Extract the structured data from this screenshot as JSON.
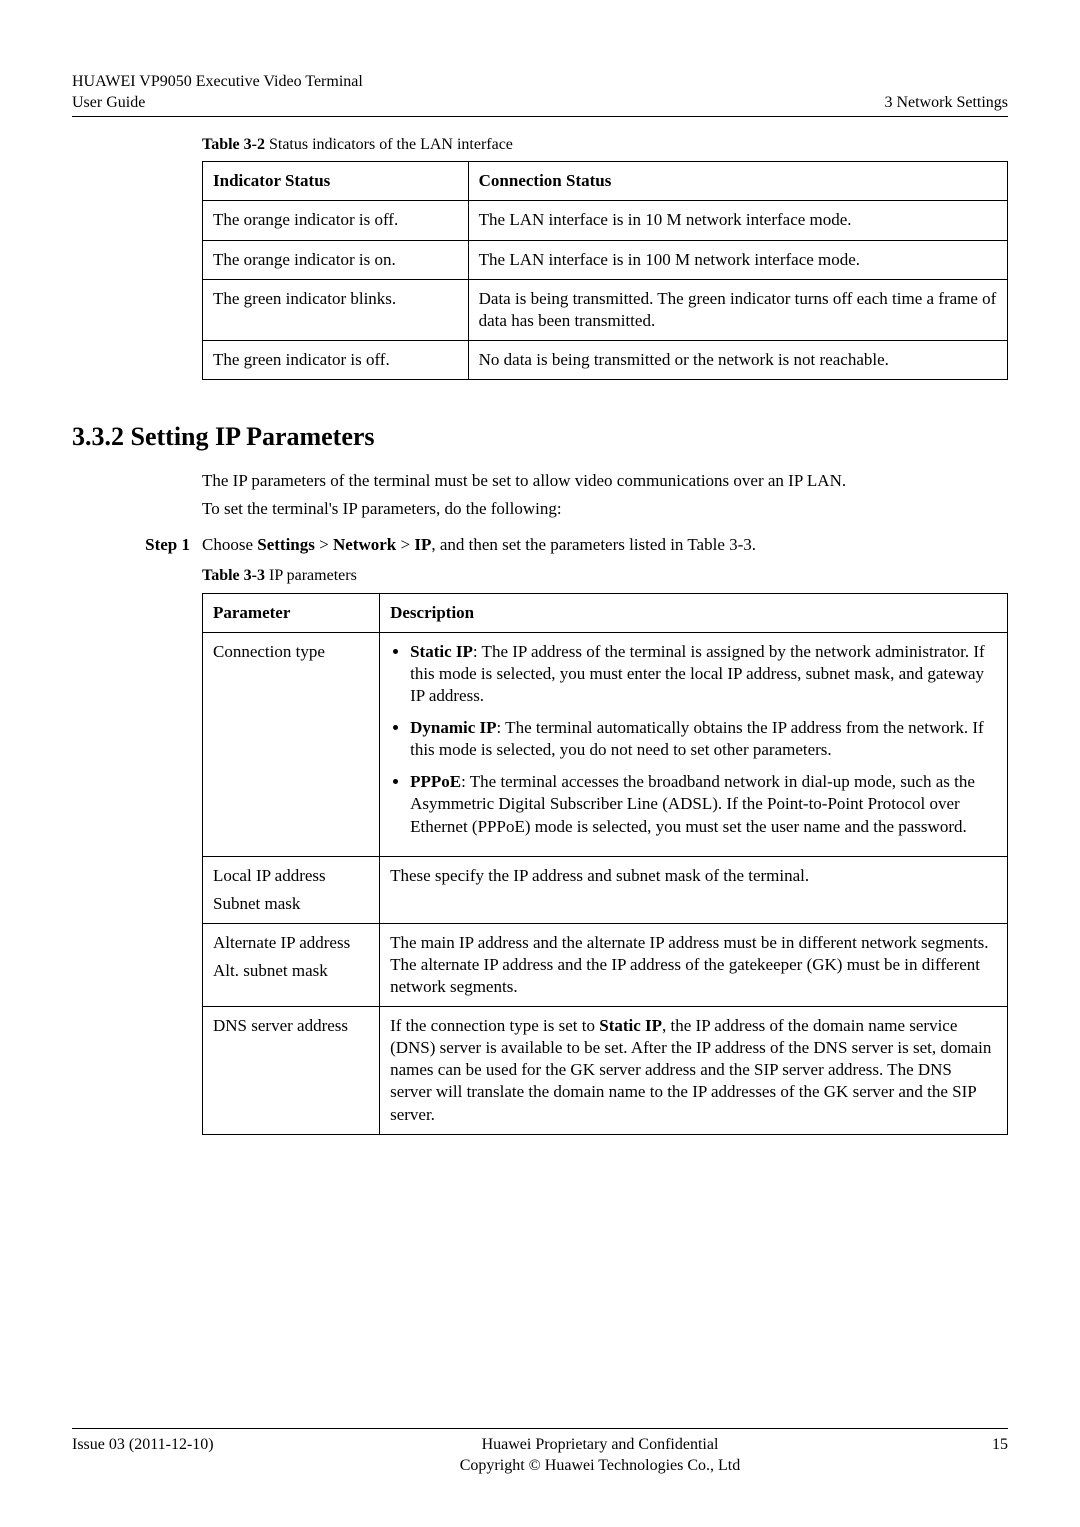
{
  "header": {
    "product": "HUAWEI VP9050 Executive Video Terminal",
    "doc": "User Guide",
    "chapter": "3 Network Settings"
  },
  "table32": {
    "caption_prefix": "Table 3-2",
    "caption_rest": " Status indicators of the LAN interface",
    "headers": {
      "h1": "Indicator Status",
      "h2": "Connection Status"
    },
    "rows": [
      {
        "c1": "The orange indicator is off.",
        "c2": "The LAN interface is in 10 M network interface mode."
      },
      {
        "c1": "The orange indicator is on.",
        "c2": "The LAN interface is in 100 M network interface mode."
      },
      {
        "c1": "The green indicator blinks.",
        "c2": "Data is being transmitted. The green indicator turns off each time a frame of data has been transmitted."
      },
      {
        "c1": "The green indicator is off.",
        "c2": "No data is being transmitted or the network is not reachable."
      }
    ]
  },
  "section": {
    "title": "3.3.2 Setting IP Parameters",
    "p1": "The IP parameters of the terminal must be set to allow video communications over an IP LAN.",
    "p2": "To set the terminal's IP parameters, do the following:",
    "step_label": "Step 1",
    "step_text_prefix": "Choose ",
    "step_settings": "Settings",
    "step_gt1": " > ",
    "step_network": "Network",
    "step_gt2": " > ",
    "step_ip": "IP",
    "step_text_suffix": ", and then set the parameters listed in Table 3-3."
  },
  "table33": {
    "caption_prefix": "Table 3-3",
    "caption_rest": " IP parameters",
    "headers": {
      "h1": "Parameter",
      "h2": "Description"
    },
    "row0": {
      "param": "Connection type",
      "li1_bold": "Static IP",
      "li1_rest": ": The IP address of the terminal is assigned by the network administrator. If this mode is selected, you must enter the local IP address, subnet mask, and gateway IP address.",
      "li2_bold": "Dynamic IP",
      "li2_rest": ": The terminal automatically obtains the IP address from the network. If this mode is selected, you do not need to set other parameters.",
      "li3_bold": "PPPoE",
      "li3_rest": ": The terminal accesses the broadband network in dial-up mode, such as the Asymmetric Digital Subscriber Line (ADSL). If the Point-to-Point Protocol over Ethernet (PPPoE) mode is selected, you must set the user name and the password."
    },
    "row1": {
      "param1": "Local IP address",
      "param2": "Subnet mask",
      "desc": "These specify the IP address and subnet mask of the terminal."
    },
    "row2": {
      "param1": "Alternate IP address",
      "param2": "Alt. subnet mask",
      "desc": "The main IP address and the alternate IP address must be in different network segments. The alternate IP address and the IP address of the gatekeeper (GK) must be in different network segments."
    },
    "row3": {
      "param": "DNS server address",
      "desc_prefix": "If the connection type is set to ",
      "desc_bold": "Static IP",
      "desc_suffix": ", the IP address of the domain name service (DNS) server is available to be set. After the IP address of the DNS server is set, domain names can be used for the GK server address and the SIP server address. The DNS server will translate the domain name to the IP addresses of the GK server and the SIP server."
    }
  },
  "footer": {
    "issue": "Issue 03 (2011-12-10)",
    "line1": "Huawei Proprietary and Confidential",
    "line2": "Copyright © Huawei Technologies Co., Ltd",
    "page": "15"
  }
}
